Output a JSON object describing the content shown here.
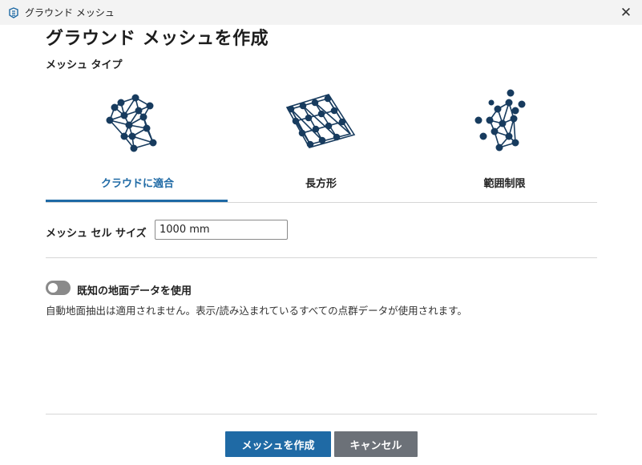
{
  "window": {
    "title": "グラウンド メッシュ",
    "close_symbol": "✕"
  },
  "dialog": {
    "heading": "グラウンド メッシュを作成",
    "mesh_type_label": "メッシュ タイプ"
  },
  "mesh_types": [
    {
      "label": "クラウドに適合",
      "icon": "fit-to-cloud-mesh-icon",
      "selected": true
    },
    {
      "label": "長方形",
      "icon": "rectangle-mesh-icon",
      "selected": false
    },
    {
      "label": "範囲制限",
      "icon": "bounded-mesh-icon",
      "selected": false
    }
  ],
  "cell_size": {
    "label": "メッシュ セル サイズ",
    "value": "1000 mm"
  },
  "known_ground": {
    "toggle_on": false,
    "label": "既知の地面データを使用",
    "description": "自動地面抽出は適用されません。表示/読み込まれているすべての点群データが使用されます。"
  },
  "buttons": {
    "create": "メッシュを作成",
    "cancel": "キャンセル"
  },
  "colors": {
    "accent": "#1f6aa5",
    "icon_navy": "#173b5e",
    "secondary_button": "#6c7178",
    "toggle_off": "#8a8a8a"
  }
}
